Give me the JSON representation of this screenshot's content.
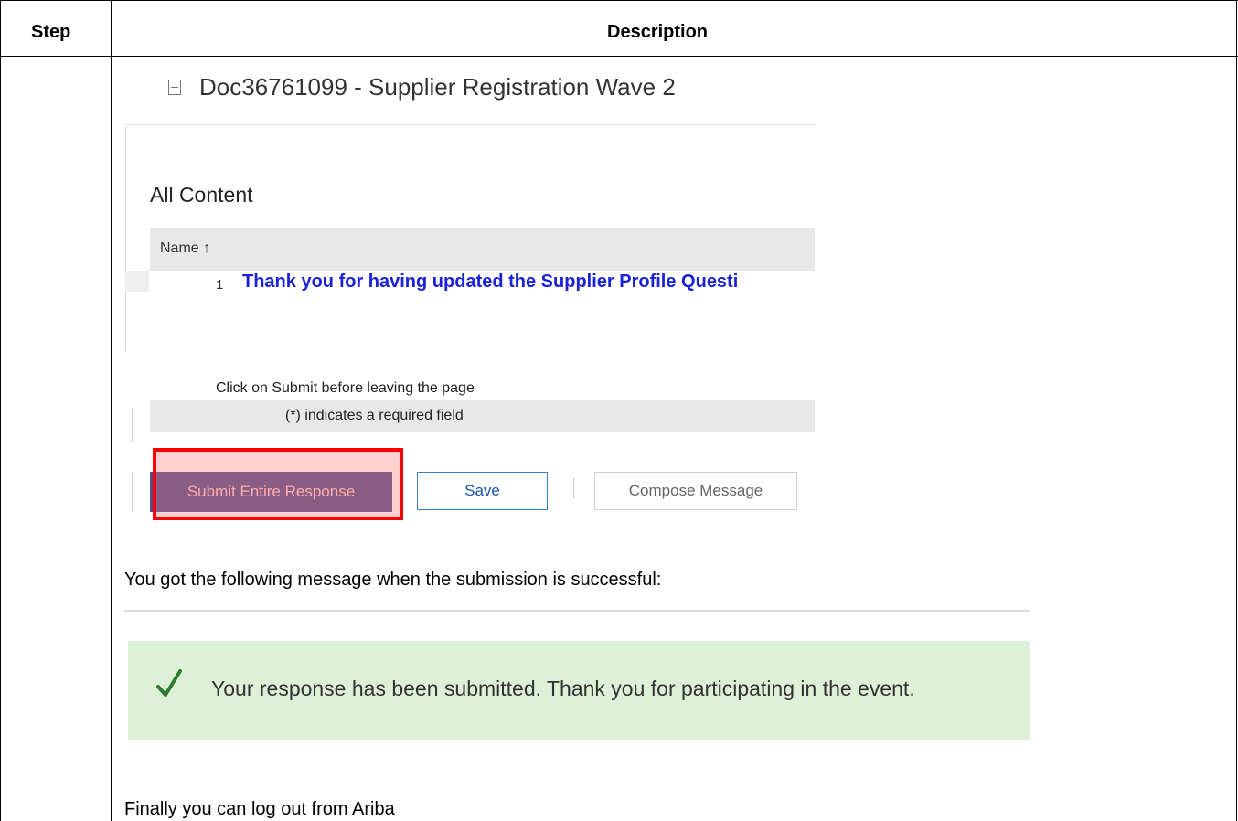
{
  "table": {
    "header_step": "Step",
    "header_description": "Description"
  },
  "document": {
    "title": "Doc36761099 - Supplier Registration Wave 2",
    "icon": "document-icon"
  },
  "content": {
    "section_title": "All Content",
    "name_column": "Name ↑",
    "row_number": "1",
    "row_text": "Thank you for having updated the Supplier Profile Questi"
  },
  "form": {
    "submit_note": "Click on Submit before leaving the page",
    "required_note": "(*) indicates a required field"
  },
  "buttons": {
    "submit": "Submit Entire Response",
    "save": "Save",
    "compose": "Compose Message"
  },
  "instructions": {
    "success_intro": "You got the following message when the submission is successful:",
    "logout": "Finally you can log out from Ariba"
  },
  "success_message": {
    "icon": "checkmark-icon",
    "text": "Your response has been submitted.  Thank you for participating in the event."
  },
  "colors": {
    "link": "#1a22d6",
    "submit_bg": "#4c4f8a",
    "highlight": "#ff0000",
    "success_bg": "#dff0d8",
    "check": "#2e7d32"
  }
}
